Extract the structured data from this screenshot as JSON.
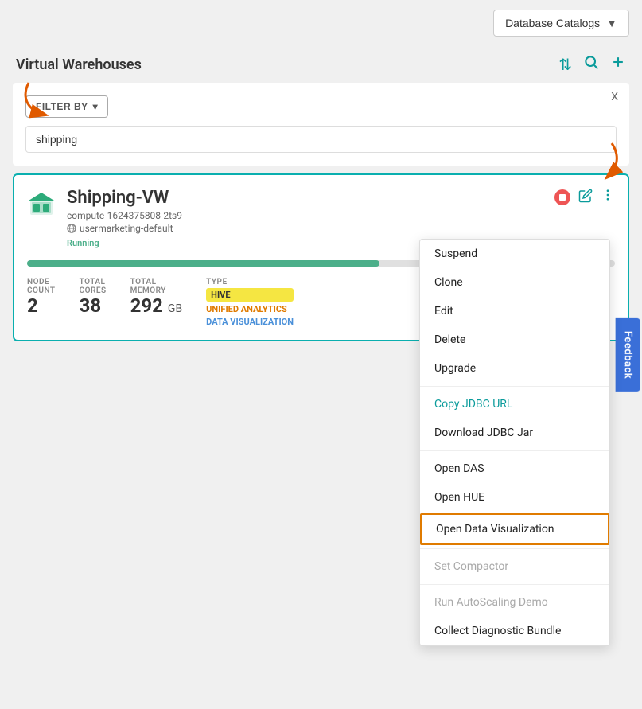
{
  "topbar": {
    "dropdown_label": "Database Catalogs",
    "dropdown_chevron": "▼"
  },
  "header": {
    "title": "Virtual Warehouses",
    "sort_icon": "⇅",
    "search_icon": "🔍",
    "add_icon": "+"
  },
  "filter": {
    "close_label": "X",
    "filter_by_label": "FILTER BY",
    "filter_by_arrow": "▾",
    "search_value": "shipping"
  },
  "vw_card": {
    "name": "Shipping-VW",
    "compute": "compute-1624375808-2ts9",
    "cluster": "usermarketing-default",
    "status": "Running",
    "node_count_label": "NODE\nCOUNT",
    "node_count_value": "2",
    "total_cores_label": "TOTAL\nCORES",
    "total_cores_value": "38",
    "total_memory_label": "TOTAL\nMEMORY",
    "total_memory_value": "292",
    "total_memory_unit": "GB",
    "type_label": "TYPE",
    "badge_hive": "HIVE",
    "badge_unified": "UNIFIED ANALYTICS",
    "badge_dataviz": "DATA VISUALIZATION"
  },
  "context_menu": {
    "items": [
      {
        "label": "Suspend",
        "type": "normal"
      },
      {
        "label": "Clone",
        "type": "normal"
      },
      {
        "label": "Edit",
        "type": "normal"
      },
      {
        "label": "Delete",
        "type": "normal"
      },
      {
        "label": "Upgrade",
        "type": "normal"
      },
      {
        "divider": true
      },
      {
        "label": "Copy JDBC URL",
        "type": "teal"
      },
      {
        "label": "Download JDBC Jar",
        "type": "normal"
      },
      {
        "divider": true
      },
      {
        "label": "Open DAS",
        "type": "normal"
      },
      {
        "label": "Open HUE",
        "type": "normal"
      },
      {
        "label": "Open Data Visualization",
        "type": "highlighted"
      },
      {
        "divider": true
      },
      {
        "label": "Set Compactor",
        "type": "disabled"
      },
      {
        "divider": true
      },
      {
        "label": "Run AutoScaling Demo",
        "type": "disabled"
      },
      {
        "label": "Collect Diagnostic Bundle",
        "type": "normal"
      }
    ]
  },
  "feedback": {
    "label": "Feedback"
  }
}
